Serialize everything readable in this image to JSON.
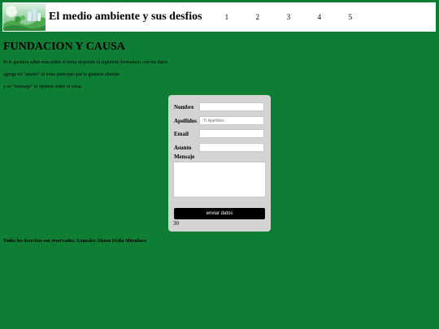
{
  "header": {
    "title": "El medio ambiente y sus desfios",
    "nav": [
      "1",
      "2",
      "3",
      "4",
      "5"
    ]
  },
  "main": {
    "heading": "FUNDACION Y CAUSA",
    "intro": [
      "Si te gustaria saber mas sobre el tema responde el siguiente formulario con tus datos",
      "agrega en \"asunto\" el tema principal que te gustaria abordar",
      "y en \"mensaje\" tu opinion sobre el tema"
    ]
  },
  "form": {
    "nombre_label": "Nombre",
    "nombre_value": "",
    "apellidos_label": "Apellidos",
    "apellidos_placeholder": "Tr Apellidos",
    "email_label": "Email",
    "email_value": "",
    "asunto_label": "Asunto",
    "asunto_value": "",
    "mensaje_label": "Mensaje",
    "mensaje_value": "",
    "submit_label": "enviar datos",
    "counter": "30"
  },
  "footer": {
    "text": "Todos los derechos son reservados. Gonzalez Alonso Iridia Miroslava"
  },
  "icons": {
    "logo": "eco-landscape-logo"
  },
  "colors": {
    "page_background": "#0f7d34",
    "header_background": "#ffffff",
    "form_background": "#d3d3d3",
    "button_background": "#000000"
  }
}
